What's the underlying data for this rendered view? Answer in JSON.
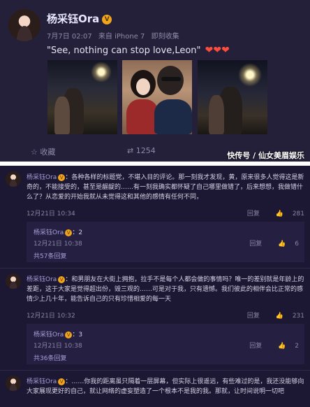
{
  "post": {
    "name": "杨采钰Ora",
    "date": "7月7日 02:07",
    "source": "来自 iPhone 7",
    "edited": "即刻收集",
    "text": "\"See, nothing can stop love,Leon\"",
    "hearts": "❤❤❤",
    "actions": {
      "favorite": "收藏",
      "repost": "1254"
    },
    "watermark": "快传号 / 仙女美眉娱乐"
  },
  "comments": [
    {
      "name": "杨采钰Ora",
      "text": "：各种各样的标题党，不堪入目的评论。那一刻我才发现，黄，原来很多人觉得这是新奇的，不能接受的，甚至是龌龊的……有一刻我确实都怀疑了自己哪里做错了，后来想想，我做错什么了？从恋爱的开始我就从未觉得这和其他的感情有任何不同，",
      "time": "12月21日 10:34",
      "reply_label": "回复",
      "likes": "281",
      "reply": {
        "name": "杨采钰Ora",
        "text": "：2",
        "time": "12月21日 10:38",
        "reply_label": "回复",
        "likes": "6"
      },
      "more": "共57条回复"
    },
    {
      "name": "杨采钰Ora",
      "text": "：和男朋友在大街上拥抱，拉手不是每个人都会做的事情吗？唯一的差别就是年龄上的差距，这于大家是觉得超出份，毁三观的……可是对于我，只有遗憾。我们彼此的相伴会比正常的感情少上几十年，能告诉自己的只有珍惜相爱的每一天",
      "time": "12月21日 10:32",
      "reply_label": "回复",
      "likes": "231",
      "reply": {
        "name": "杨采钰Ora",
        "text": "：3",
        "time": "12月21日 10:38",
        "reply_label": "回复",
        "likes": "2"
      },
      "more": "共36条回复"
    },
    {
      "name": "杨采钰Ora",
      "text": "：……你我的距离虽只隔着一层屏幕，但实际上很遥远，有些难过的是，我还没能够向大家展现更好的自己，就让网络的虚妄塑造了一个根本不是我的我。那就，让时间说明一切吧"
    }
  ]
}
